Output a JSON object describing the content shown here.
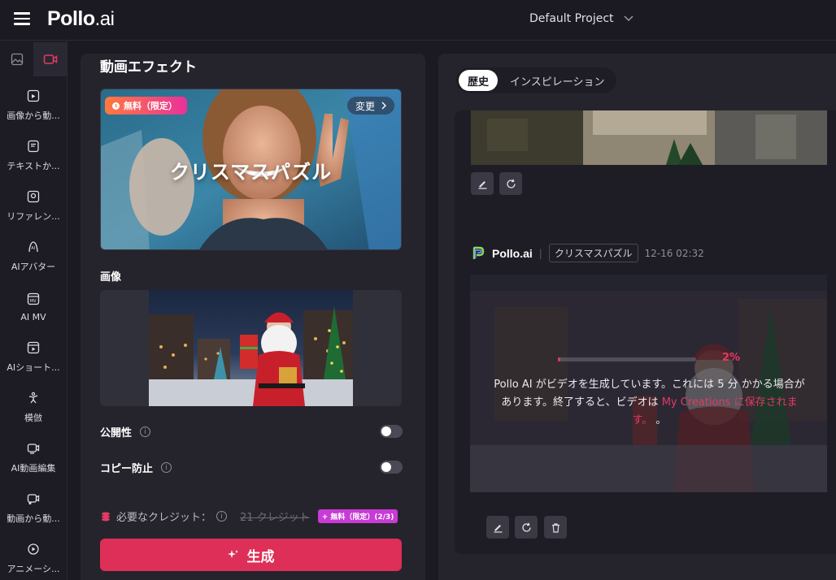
{
  "app": {
    "logo_main": "Pollo",
    "logo_suffix": ".ai"
  },
  "header": {
    "project_name": "Default Project"
  },
  "sidebar": {
    "items": [
      {
        "label": "画像から動..."
      },
      {
        "label": "テキストか..."
      },
      {
        "label": "リファレン..."
      },
      {
        "label": "AIアバター"
      },
      {
        "label": "AI MV"
      },
      {
        "label": "AIショート..."
      },
      {
        "label": "模倣"
      },
      {
        "label": "AI動画編集"
      },
      {
        "label": "動画から動..."
      },
      {
        "label": "アニメーシ..."
      }
    ]
  },
  "left_panel": {
    "title": "動画エフェクト",
    "effect": {
      "free_badge": "無料（限定）",
      "change_label": "変更",
      "name": "クリスマスパズル"
    },
    "image_label": "画像",
    "public_label": "公開性",
    "copy_protect_label": "コピー防止",
    "credits": {
      "label": "必要なクレジット：",
      "original": "21 クレジット",
      "badge": "+ 無料（限定）(2/3)"
    },
    "generate_label": "生成"
  },
  "right_panel": {
    "tabs": [
      {
        "label": "歴史"
      },
      {
        "label": "インスピレーション"
      }
    ],
    "card2": {
      "brand": "Pollo.ai",
      "tag": "クリスマスパズル",
      "time": "12-16 02:32",
      "progress_percent": 2,
      "progress_label": "2%",
      "message_1": "Pollo AI がビデオを生成しています。これには 5 分 かかる場合があります。終了すると、ビデオは ",
      "message_link": "My Creations に保存されます。",
      "message_end": " 。"
    }
  },
  "colors": {
    "accent": "#dd2f57",
    "badge_gradient_start": "#ff7a3d",
    "badge_gradient_end": "#e9319a",
    "credit_badge": "#c83bd6"
  }
}
